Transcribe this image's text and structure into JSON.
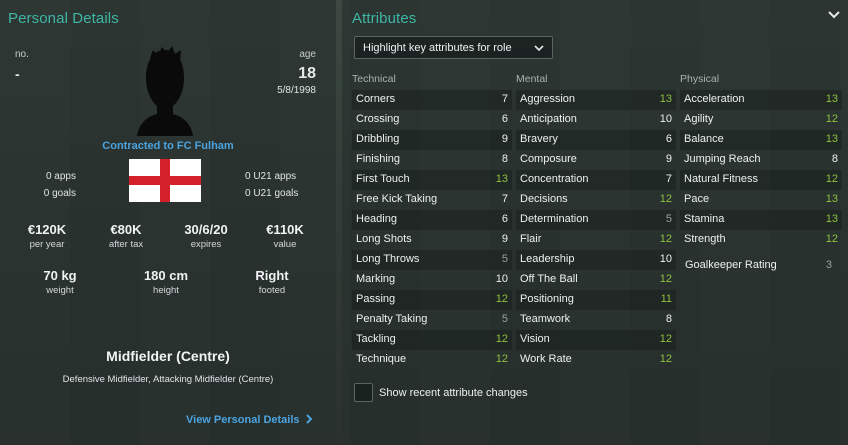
{
  "left": {
    "title": "Personal Details",
    "no_label": "no.",
    "no_value": "-",
    "age_label": "age",
    "age_value": "18",
    "dob": "5/8/1998",
    "contract": "Contracted to FC Fulham",
    "flag": "england-flag",
    "apps": "0 apps",
    "goals": "0 goals",
    "u21_apps": "0 U21 apps",
    "u21_goals": "0 U21 goals",
    "finance": [
      {
        "value": "€120K",
        "label": "per year"
      },
      {
        "value": "€80K",
        "label": "after tax"
      },
      {
        "value": "30/6/20",
        "label": "expires"
      },
      {
        "value": "€110K",
        "label": "value"
      }
    ],
    "physical": [
      {
        "value": "70 kg",
        "label": "weight"
      },
      {
        "value": "180 cm",
        "label": "height"
      },
      {
        "value": "Right",
        "label": "footed"
      }
    ],
    "position_main": "Midfielder (Centre)",
    "position_sub": "Defensive Midfielder, Attacking Midfielder (Centre)",
    "view_details": "View Personal Details",
    "view_details_icon": "chevron-right-icon"
  },
  "right": {
    "title": "Attributes",
    "collapse_icon": "chevron-down-icon",
    "highlight_dropdown": "Highlight key attributes for role",
    "columns": {
      "technical": {
        "heading": "Technical",
        "items": [
          {
            "name": "Corners",
            "value": "7"
          },
          {
            "name": "Crossing",
            "value": "6"
          },
          {
            "name": "Dribbling",
            "value": "9"
          },
          {
            "name": "Finishing",
            "value": "8"
          },
          {
            "name": "First Touch",
            "value": "13"
          },
          {
            "name": "Free Kick Taking",
            "value": "7"
          },
          {
            "name": "Heading",
            "value": "6"
          },
          {
            "name": "Long Shots",
            "value": "9"
          },
          {
            "name": "Long Throws",
            "value": "5"
          },
          {
            "name": "Marking",
            "value": "10"
          },
          {
            "name": "Passing",
            "value": "12"
          },
          {
            "name": "Penalty Taking",
            "value": "5"
          },
          {
            "name": "Tackling",
            "value": "12"
          },
          {
            "name": "Technique",
            "value": "12"
          }
        ]
      },
      "mental": {
        "heading": "Mental",
        "items": [
          {
            "name": "Aggression",
            "value": "13"
          },
          {
            "name": "Anticipation",
            "value": "10"
          },
          {
            "name": "Bravery",
            "value": "6"
          },
          {
            "name": "Composure",
            "value": "9"
          },
          {
            "name": "Concentration",
            "value": "7"
          },
          {
            "name": "Decisions",
            "value": "12"
          },
          {
            "name": "Determination",
            "value": "5"
          },
          {
            "name": "Flair",
            "value": "12"
          },
          {
            "name": "Leadership",
            "value": "10"
          },
          {
            "name": "Off The Ball",
            "value": "12"
          },
          {
            "name": "Positioning",
            "value": "11"
          },
          {
            "name": "Teamwork",
            "value": "8"
          },
          {
            "name": "Vision",
            "value": "12"
          },
          {
            "name": "Work Rate",
            "value": "12"
          }
        ]
      },
      "physical": {
        "heading": "Physical",
        "items": [
          {
            "name": "Acceleration",
            "value": "13"
          },
          {
            "name": "Agility",
            "value": "12"
          },
          {
            "name": "Balance",
            "value": "13"
          },
          {
            "name": "Jumping Reach",
            "value": "8"
          },
          {
            "name": "Natural Fitness",
            "value": "12"
          },
          {
            "name": "Pace",
            "value": "13"
          },
          {
            "name": "Stamina",
            "value": "13"
          },
          {
            "name": "Strength",
            "value": "12"
          }
        ]
      }
    },
    "goalkeeper_rating": {
      "name": "Goalkeeper Rating",
      "value": "3"
    },
    "show_changes": "Show recent attribute changes"
  }
}
